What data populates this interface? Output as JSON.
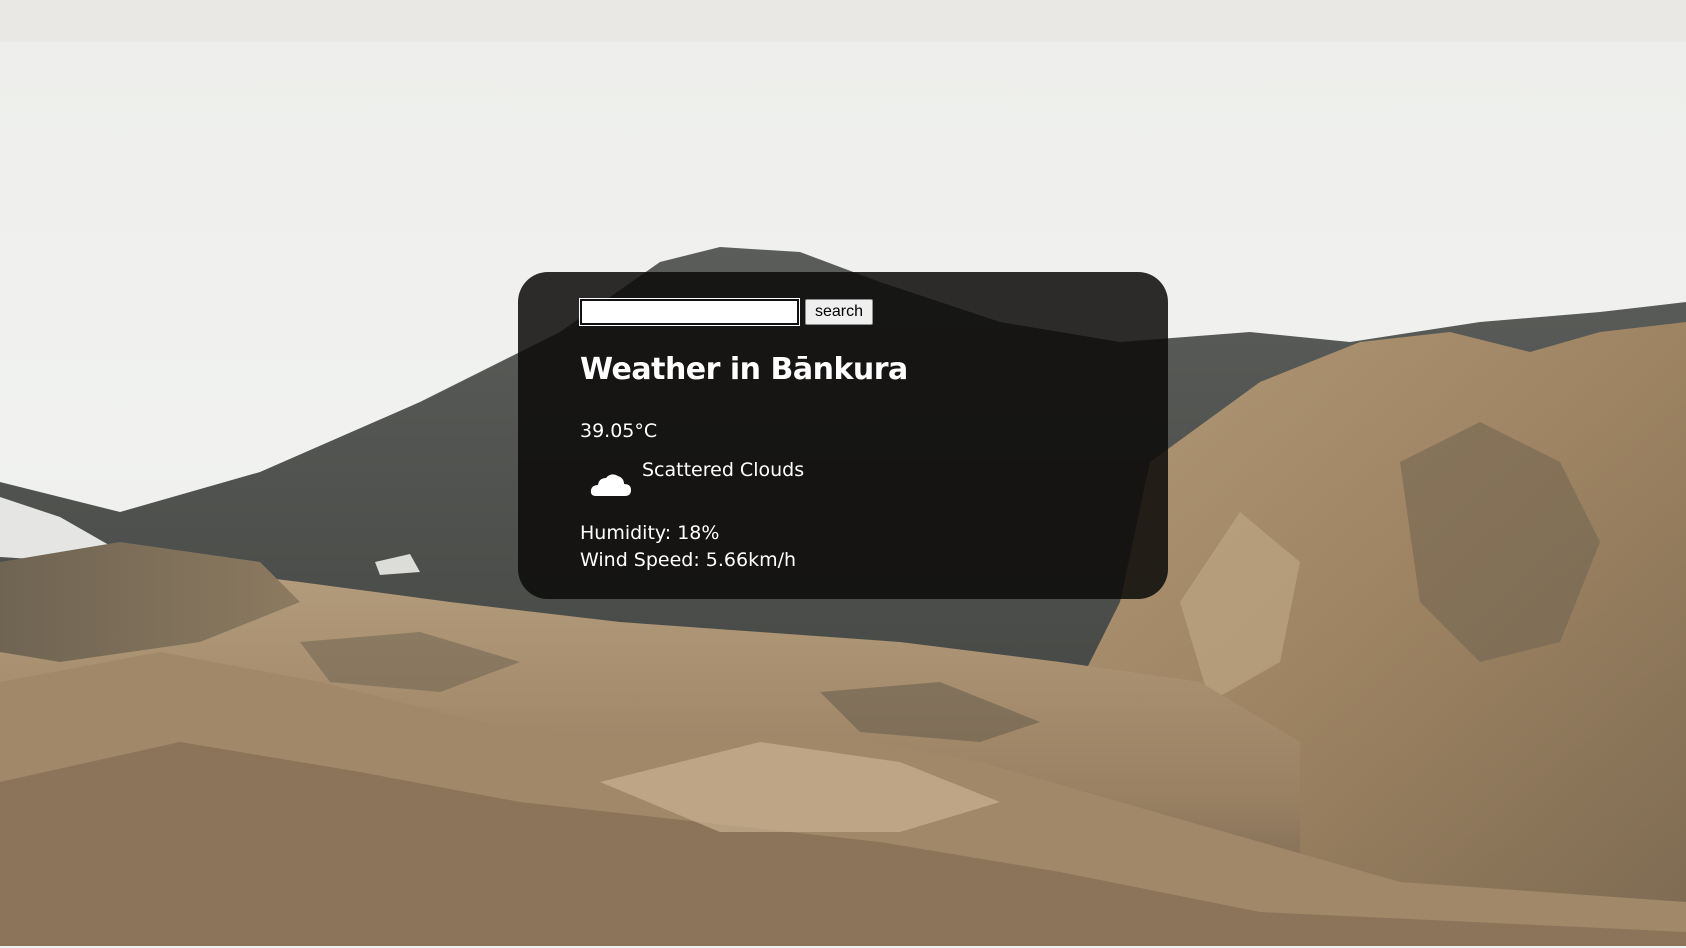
{
  "search": {
    "value": "",
    "placeholder": "",
    "button_label": "search"
  },
  "weather": {
    "title": "Weather in Bānkura",
    "temperature": "39.05°C",
    "condition": "Scattered Clouds",
    "condition_icon": "cloud-icon",
    "humidity": "Humidity: 18%",
    "wind_speed": "Wind Speed: 5.66km/h"
  },
  "colors": {
    "card_background": "#0c0a09",
    "text": "#ffffff"
  }
}
